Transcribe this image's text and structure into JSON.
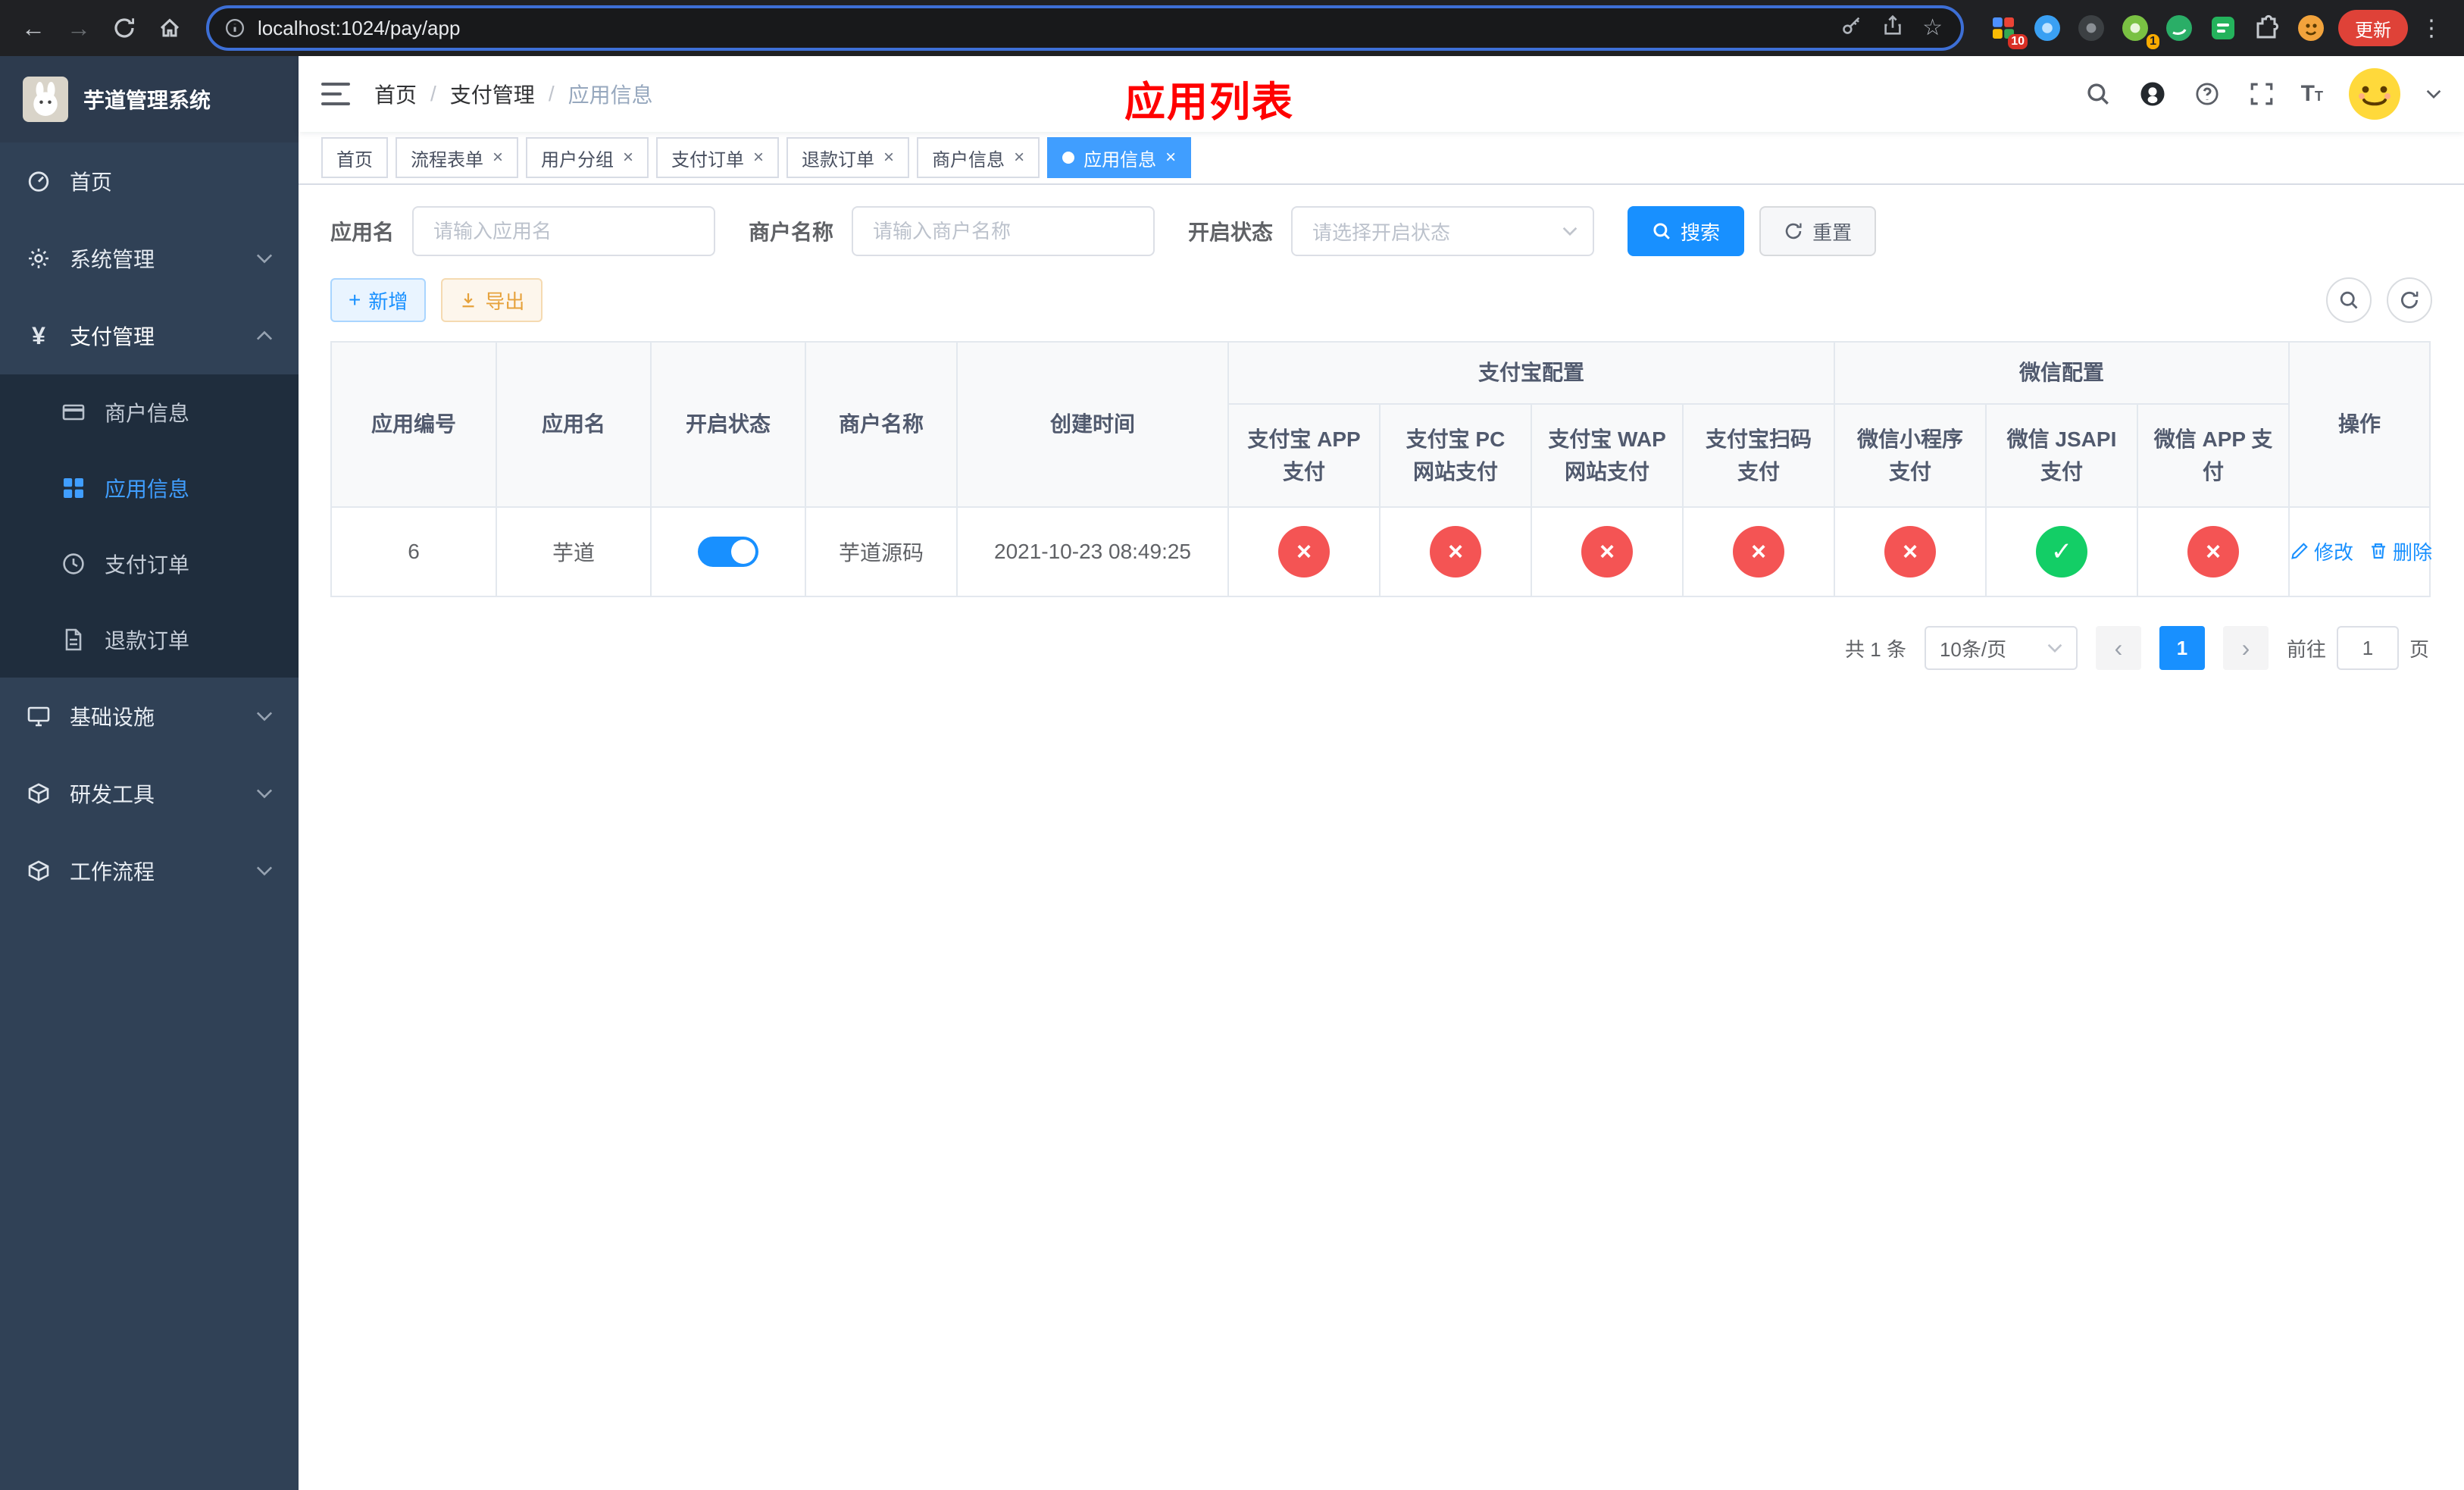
{
  "colors": {
    "accent_blue": "#1890ff",
    "sidebar_active_blue": "#409eff",
    "status_red": "#f45454",
    "status_green": "#13ce66",
    "title_red": "#ff0000",
    "warning_orange": "#e6a23c",
    "sidebar_bg": "#304156",
    "submenu_bg": "#1f2d3d"
  },
  "browser": {
    "url": "localhost:1024/pay/app",
    "update_button": "更新",
    "ext_badge_10": "10",
    "ext_badge_1": "1"
  },
  "sidebar": {
    "title": "芋道管理系统",
    "items": [
      {
        "label": "首页"
      },
      {
        "label": "系统管理"
      },
      {
        "label": "支付管理"
      },
      {
        "label": "基础设施"
      },
      {
        "label": "研发工具"
      },
      {
        "label": "工作流程"
      }
    ],
    "submenu": [
      {
        "label": "商户信息"
      },
      {
        "label": "应用信息"
      },
      {
        "label": "支付订单"
      },
      {
        "label": "退款订单"
      }
    ]
  },
  "header": {
    "breadcrumb": [
      "首页",
      "支付管理",
      "应用信息"
    ],
    "page_title": "应用列表"
  },
  "tabs": [
    {
      "label": "首页"
    },
    {
      "label": "流程表单"
    },
    {
      "label": "用户分组"
    },
    {
      "label": "支付订单"
    },
    {
      "label": "退款订单"
    },
    {
      "label": "商户信息"
    },
    {
      "label": "应用信息"
    }
  ],
  "filters": {
    "app_name_label": "应用名",
    "app_name_placeholder": "请输入应用名",
    "merchant_label": "商户名称",
    "merchant_placeholder": "请输入商户名称",
    "status_label": "开启状态",
    "status_placeholder": "请选择开启状态",
    "search_label": "搜索",
    "reset_label": "重置"
  },
  "toolbar": {
    "add_label": "新增",
    "export_label": "导出"
  },
  "table": {
    "group_alipay": "支付宝配置",
    "group_wechat": "微信配置",
    "columns_main": [
      "应用编号",
      "应用名",
      "开启状态",
      "商户名称",
      "创建时间",
      "操作"
    ],
    "columns_alipay": [
      "支付宝 APP 支付",
      "支付宝 PC 网站支付",
      "支付宝 WAP 网站支付",
      "支付宝扫码支付"
    ],
    "columns_wechat": [
      "微信小程序支付",
      "微信 JSAPI 支付",
      "微信 APP 支付"
    ],
    "rows": [
      {
        "app_id": "6",
        "app_name": "芋道",
        "status_on": true,
        "merchant_name": "芋道源码",
        "create_time": "2021-10-23 08:49:25",
        "pay_configs": [
          false,
          false,
          false,
          false,
          false,
          true,
          false
        ],
        "edit_label": "修改",
        "delete_label": "删除"
      }
    ]
  },
  "pagination": {
    "total_text": "共 1 条",
    "page_size": "10条/页",
    "current_page": "1",
    "goto_prefix": "前往",
    "goto_value": "1",
    "goto_suffix": "页"
  }
}
